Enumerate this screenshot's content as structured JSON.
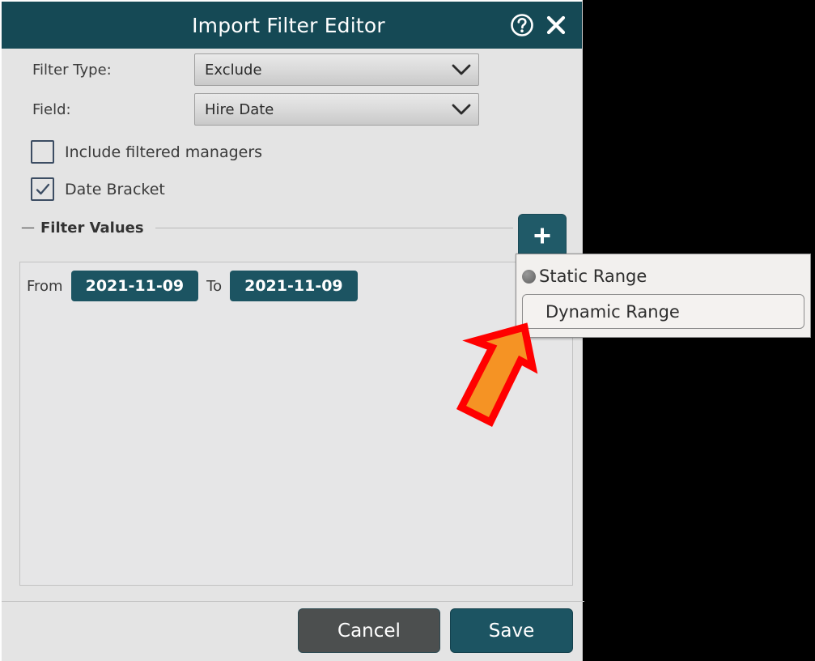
{
  "window": {
    "title": "Import Filter Editor",
    "help_icon": "question-mark-circle-icon",
    "close_icon": "close-x-icon",
    "titlebar_color": "#154955",
    "background_color": "#e4e4e4"
  },
  "form": {
    "filter_type": {
      "label": "Filter Type:",
      "value": "Exclude",
      "options": [
        "Exclude"
      ]
    },
    "field": {
      "label": "Field:",
      "value": "Hire Date",
      "options": [
        "Hire Date"
      ]
    },
    "include_filtered_managers": {
      "label": "Include filtered managers",
      "checked": false
    },
    "date_bracket": {
      "label": "Date Bracket",
      "checked": true,
      "check_glyph": "checkmark-icon"
    }
  },
  "filter_values": {
    "group_title": "Filter Values",
    "collapse_glyph": "—",
    "add_button_glyph": "+",
    "range_row": {
      "from_label": "From",
      "from_value": "2021-11-09",
      "to_label": "To",
      "to_value": "2021-11-09"
    }
  },
  "popup_menu": {
    "items": [
      {
        "label": "Static Range",
        "icon": "filled-radio-dot-icon",
        "selected": false
      },
      {
        "label": "Dynamic Range",
        "icon": "",
        "selected": true
      }
    ]
  },
  "footer": {
    "cancel_label": "Cancel",
    "save_label": "Save"
  },
  "annotation": {
    "arrow_icon": "up-right-arrow-pointer",
    "fill_color": "#F59324",
    "stroke_color": "#FF0000"
  },
  "colors": {
    "teal": "#1c5462",
    "teal_dark": "#154955",
    "panel": "#e6e6e7",
    "button_gray": "#4c4f4f"
  }
}
